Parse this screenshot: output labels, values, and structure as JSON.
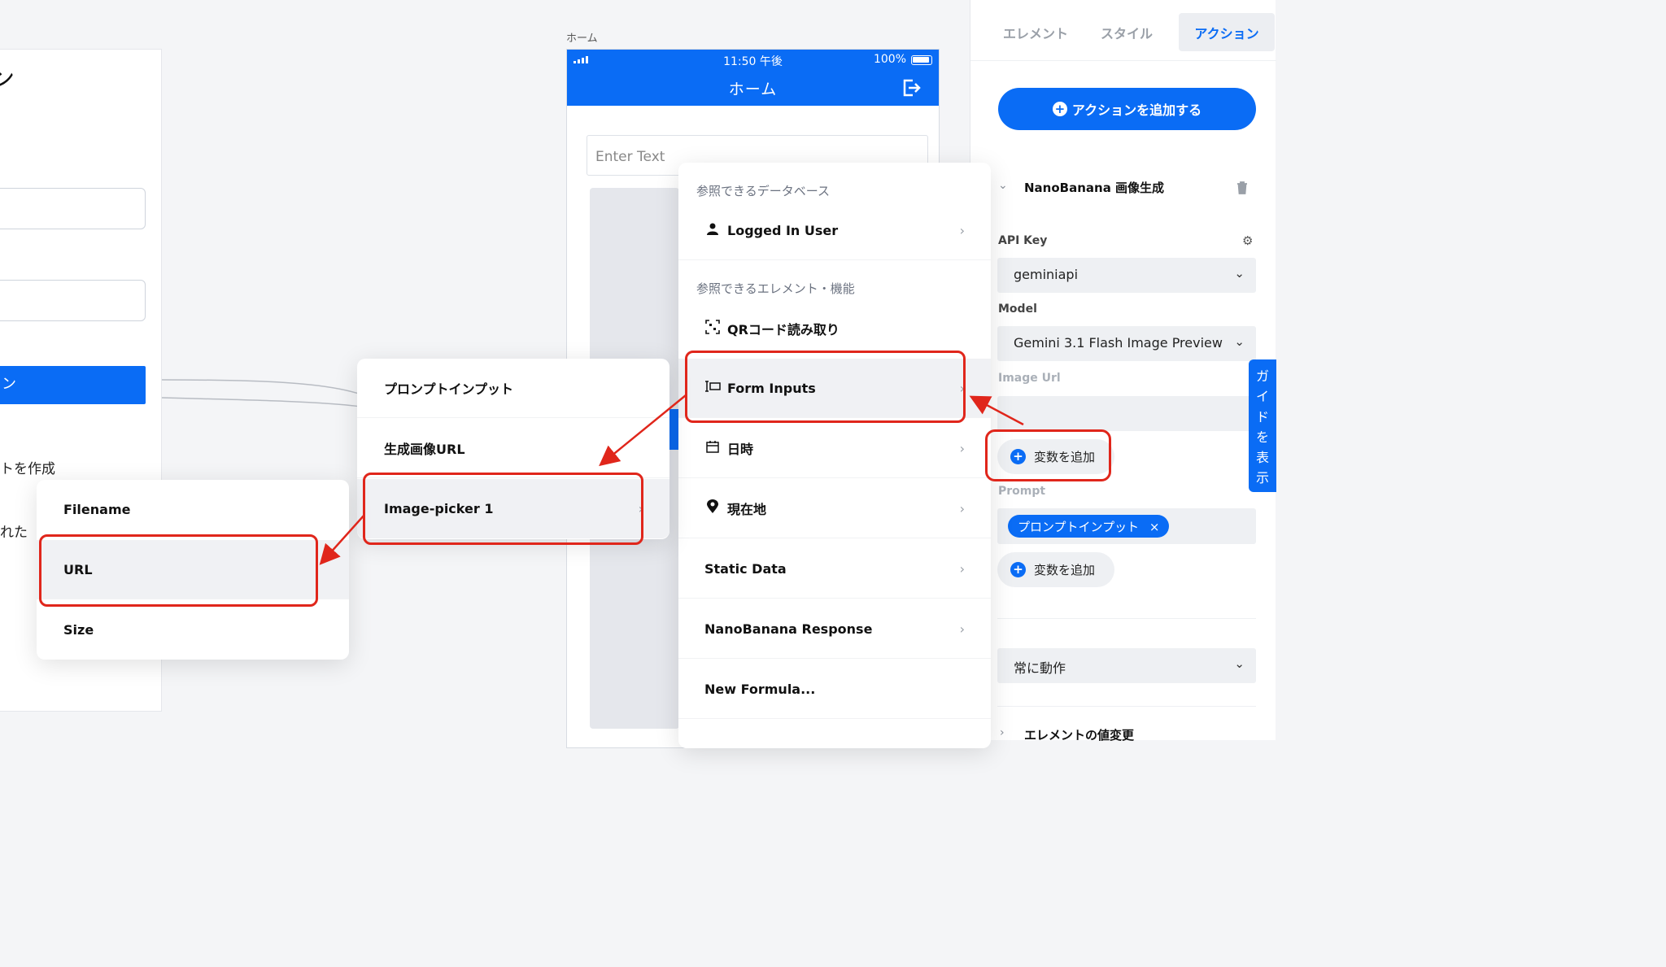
{
  "login": {
    "title_fragment": "ン",
    "button_fragment": "ン",
    "text1": "トを作成",
    "text2": "れた"
  },
  "phone": {
    "label": "ホーム",
    "time": "11:50 午後",
    "battery": "100%",
    "title": "ホーム",
    "input_placeholder": "Enter Text"
  },
  "db_menu": {
    "heading_db": "参照できるデータベース",
    "heading_elements": "参照できるエレメント・機能",
    "items": [
      {
        "label": "Logged In User",
        "icon": "user-icon"
      },
      {
        "label": "QRコード読み取り",
        "icon": "qr-scan-icon"
      },
      {
        "label": "Form Inputs",
        "icon": "form-input-icon"
      },
      {
        "label": "日時",
        "icon": "calendar-icon"
      },
      {
        "label": "現在地",
        "icon": "location-pin-icon"
      },
      {
        "label": "Static Data",
        "icon": ""
      },
      {
        "label": "NanoBanana Response",
        "icon": ""
      },
      {
        "label": "New Formula...",
        "icon": ""
      }
    ]
  },
  "form_inputs_menu": {
    "items": [
      "プロンプトインプット",
      "生成画像URL",
      "Image-picker 1"
    ]
  },
  "image_picker_menu": {
    "items": [
      "Filename",
      "URL",
      "Size"
    ]
  },
  "panel": {
    "tabs": [
      "エレメント",
      "スタイル",
      "アクション"
    ],
    "active_tab": "アクション",
    "add_action": "アクションを追加する",
    "section_title": "NanoBanana 画像生成",
    "api_key_label": "API Key",
    "api_key_value": "geminiapi",
    "model_label": "Model",
    "model_value": "Gemini 3.1 Flash Image Preview",
    "image_url_label": "Image Url",
    "add_variable": "変数を追加",
    "prompt_label": "Prompt",
    "prompt_chip": "プロンプトインプット",
    "trigger_value": "常に動作",
    "next_section": "エレメントの値変更",
    "guide_tab": "ガイドを表示"
  },
  "colors": {
    "accent": "#0a6cf5",
    "annotation_red": "#e0261b"
  }
}
